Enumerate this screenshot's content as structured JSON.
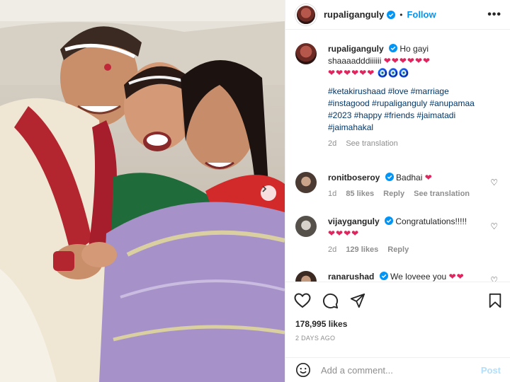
{
  "post": {
    "username": "rupaliganguly",
    "follow_label": "Follow",
    "dot": "•",
    "more": "•••"
  },
  "caption": {
    "username": "rupaliganguly",
    "text": "Ho gayi shaaaadddiiiiii",
    "hearts_line1": "❤❤❤❤❤❤",
    "hearts_line2": "❤❤❤❤❤❤",
    "evil_eyes": "🧿🧿🧿",
    "hashtags": "#ketakirushaad #love #marriage #instagood #rupaliganguly #anupamaa #2023 #happy #friends #jaimatadi #jaimahakal",
    "time": "2d",
    "see_translation": "See translation"
  },
  "comments": [
    {
      "username": "ronitboseroy",
      "text": "Badhai",
      "hearts": "❤",
      "time": "1d",
      "likes": "85 likes",
      "reply": "Reply",
      "see_translation": "See translation"
    },
    {
      "username": "vijayganguly",
      "text": "Congratulations!!!!!",
      "hearts": "❤❤❤❤",
      "time": "2d",
      "likes": "129 likes",
      "reply": "Reply"
    },
    {
      "username": "ranarushad",
      "text": "We loveee you",
      "hearts": "❤❤"
    }
  ],
  "footer": {
    "likes": "178,995 likes",
    "date": "2 DAYS AGO",
    "add_comment_placeholder": "Add a comment...",
    "post_label": "Post"
  },
  "icons": {
    "like": "heart-icon",
    "comment": "comment-icon",
    "share": "share-icon",
    "save": "bookmark-icon",
    "emoji": "emoji-icon",
    "next": "chevron-right-icon"
  },
  "colors": {
    "accent": "#0095f6",
    "hashtag": "#00376b",
    "muted": "#8e8e8e",
    "heart": "#e0245e",
    "post_disabled": "#b2dffc"
  }
}
